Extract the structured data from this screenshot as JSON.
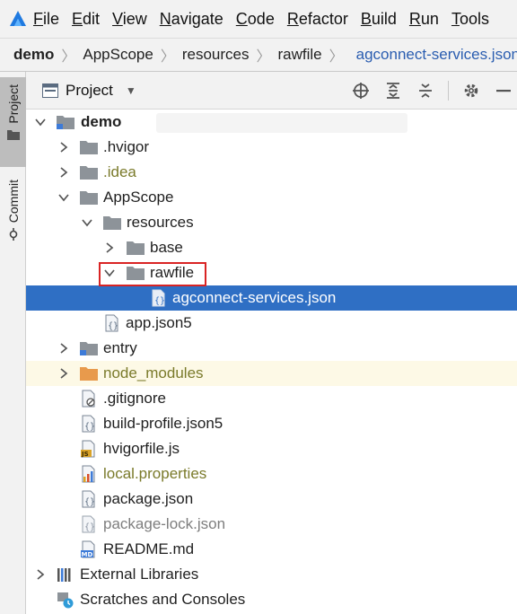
{
  "menubar": {
    "items": [
      {
        "mnemonic": "F",
        "rest": "ile"
      },
      {
        "mnemonic": "E",
        "rest": "dit"
      },
      {
        "mnemonic": "V",
        "rest": "iew"
      },
      {
        "mnemonic": "N",
        "rest": "avigate"
      },
      {
        "mnemonic": "C",
        "rest": "ode"
      },
      {
        "mnemonic": "R",
        "rest": "efactor"
      },
      {
        "mnemonic": "B",
        "rest": "uild"
      },
      {
        "mnemonic": "R",
        "rest": "un"
      },
      {
        "mnemonic": "T",
        "rest": "ools"
      }
    ]
  },
  "breadcrumb": {
    "items": [
      "demo",
      "AppScope",
      "resources",
      "rawfile",
      "agconnect-services.json"
    ]
  },
  "toolstrip": {
    "project_label": "Project",
    "commit_label": "Commit"
  },
  "panel": {
    "title": "Project",
    "dropdown_icon": "triangle-down-icon",
    "tools": [
      "locate-icon",
      "expand-all-icon",
      "collapse-all-icon",
      "settings-icon",
      "hide-icon"
    ]
  },
  "tree": {
    "root": "demo",
    "hvigor": ".hvigor",
    "idea": ".idea",
    "appscope": "AppScope",
    "resources": "resources",
    "base": "base",
    "rawfile": "rawfile",
    "agconnect": "agconnect-services.json",
    "appjson5": "app.json5",
    "entry": "entry",
    "node_modules": "node_modules",
    "gitignore": ".gitignore",
    "build_profile": "build-profile.json5",
    "hvigorfile": "hvigorfile.js",
    "local_properties": "local.properties",
    "package_json": "package.json",
    "package_lock": "package-lock.json",
    "readme": "README.md",
    "external_libraries": "External Libraries",
    "scratches": "Scratches and Consoles",
    "js_badge": "JS",
    "md_badge": "MD"
  },
  "colors": {
    "selection": "#2f6fc4",
    "highlight_row": "#fdf9e6",
    "annotation_box": "#d92424",
    "folder": "#8d9399",
    "excluded_folder": "#e89a4c"
  }
}
